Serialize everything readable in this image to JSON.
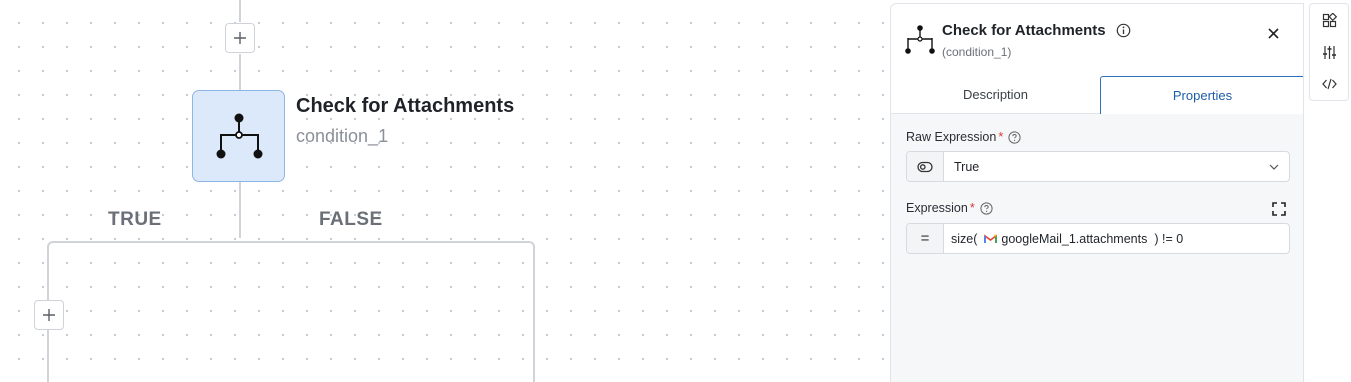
{
  "canvas": {
    "node": {
      "title": "Check for Attachments",
      "id": "condition_1"
    },
    "branches": {
      "true_label": "TRUE",
      "false_label": "FALSE"
    }
  },
  "panel": {
    "title": "Check for Attachments",
    "subtitle": "(condition_1)",
    "tabs": [
      {
        "label": "Description",
        "active": false
      },
      {
        "label": "Properties",
        "active": true
      }
    ],
    "raw_expression": {
      "label": "Raw Expression",
      "required_mark": "*",
      "value": "True"
    },
    "expression": {
      "label": "Expression",
      "required_mark": "*",
      "prefix": "=",
      "text_before": "size(",
      "chip_text": "googleMail_1.attachments",
      "text_after": ") != 0"
    }
  },
  "colors": {
    "node_fill": "#dce9fb",
    "node_border": "#8fb6e8",
    "active_tab": "#1f5fa8",
    "required": "#d93838",
    "gmail_red": "#ea4335",
    "gmail_blue": "#4285f4",
    "gmail_green": "#34a853",
    "gmail_yellow": "#fbbc04"
  }
}
